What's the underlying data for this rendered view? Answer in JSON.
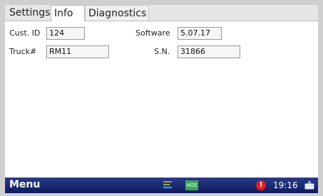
{
  "tabs": [
    "Settings",
    "Info",
    "Diagnostics"
  ],
  "active_tab": "Info",
  "fields": {
    "cust_id": {
      "label": "Cust. ID",
      "value": "124"
    },
    "truck": {
      "label": "Truck#",
      "value": "RM11"
    },
    "software": {
      "label": "Software",
      "value": "5.07.17"
    },
    "sn": {
      "label": "S.N.",
      "value": "31866"
    }
  },
  "taskbar": {
    "menu_label": "Menu",
    "hos_label": "HOS",
    "alert_symbol": "!",
    "clock": "19:16"
  },
  "colors": {
    "taskbar": "#1a2a78",
    "hos": "#3aa655",
    "alert": "#e02020"
  }
}
